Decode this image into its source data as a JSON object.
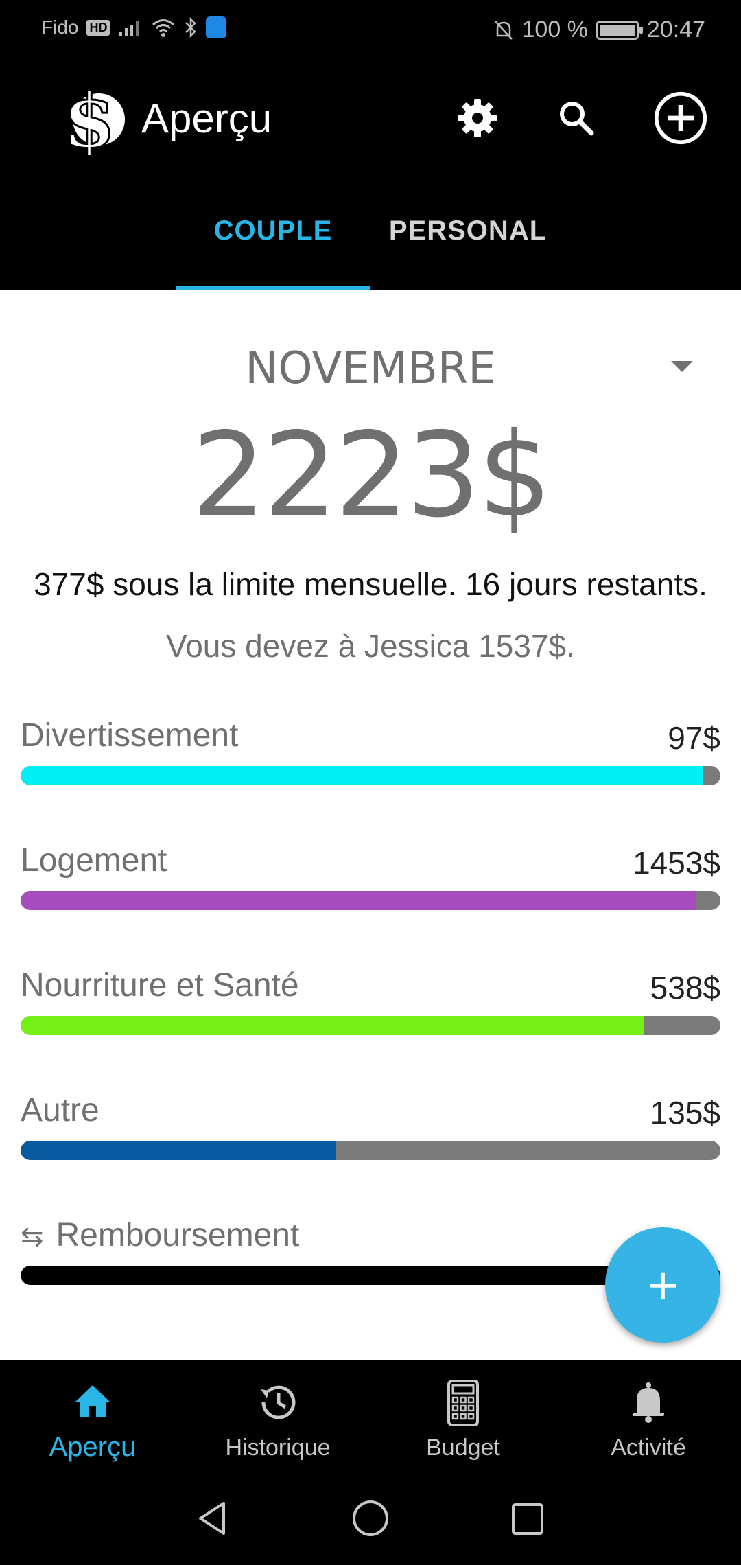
{
  "status_bar": {
    "carrier": "Fido",
    "hd_badge": "HD",
    "battery": "100 %",
    "time": "20:47"
  },
  "app_bar": {
    "title": "Aperçu",
    "icons": [
      "dollar-logo-icon",
      "gear-icon",
      "search-icon",
      "add-circle-icon"
    ]
  },
  "tabs": [
    {
      "label": "COUPLE",
      "active": true
    },
    {
      "label": "PERSONAL",
      "active": false
    }
  ],
  "summary": {
    "month": "NOVEMBRE",
    "total": "2223$",
    "limit_text": "377$ sous la limite mensuelle. 16 jours restants.",
    "owe_text": "Vous devez à Jessica 1537$."
  },
  "categories": [
    {
      "name": "Divertissement",
      "amount": "97$",
      "progress": 0.975,
      "color": "#00f0f5"
    },
    {
      "name": "Logement",
      "amount": "1453$",
      "progress": 0.965,
      "color": "#a64cbf"
    },
    {
      "name": "Nourriture et Santé",
      "amount": "538$",
      "progress": 0.89,
      "color": "#76f014"
    },
    {
      "name": "Autre",
      "amount": "135$",
      "progress": 0.45,
      "color": "#0a5aa0"
    }
  ],
  "reimbursement": {
    "name": "Remboursement",
    "icon": "swap-arrows-icon",
    "progress": 1.0,
    "color": "#000000"
  },
  "fab_label": "+",
  "bottom_nav": [
    {
      "label": "Aperçu",
      "icon": "home-icon",
      "active": true
    },
    {
      "label": "Historique",
      "icon": "history-icon",
      "active": false
    },
    {
      "label": "Budget",
      "icon": "calculator-icon",
      "active": false
    },
    {
      "label": "Activité",
      "icon": "bell-icon",
      "active": false
    }
  ],
  "colors": {
    "accent": "#29b6e6",
    "fab": "#36b4e5",
    "muted_text": "#707070",
    "track": "#7a7a7a"
  }
}
